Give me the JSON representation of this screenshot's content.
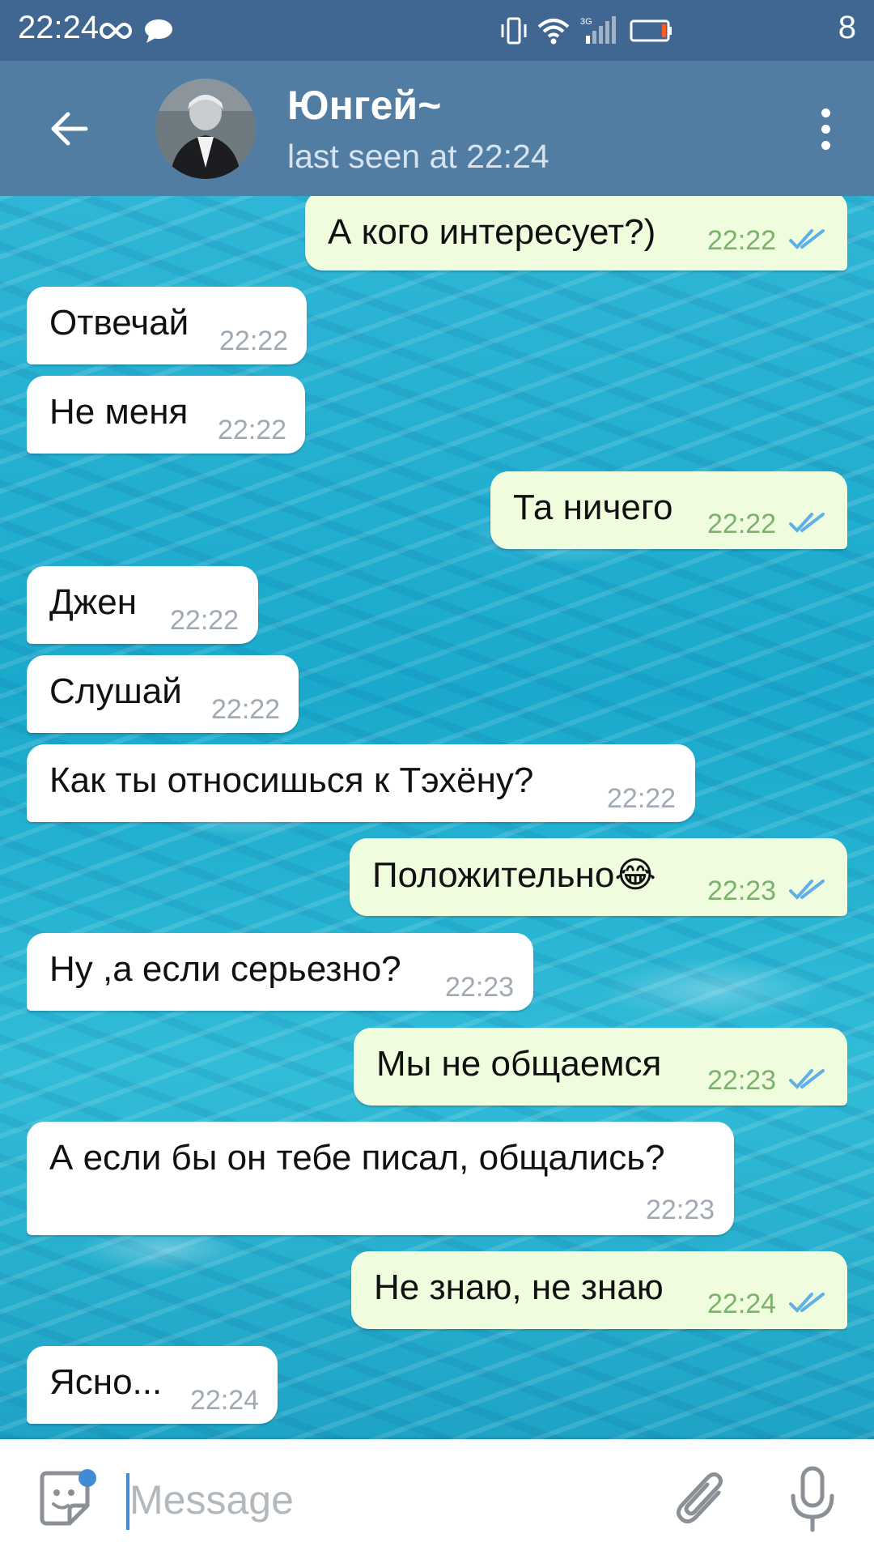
{
  "status_bar": {
    "time": "22:24",
    "battery_level": "8"
  },
  "header": {
    "title": "Юнгей~",
    "status": "last seen at 22:24"
  },
  "messages": [
    {
      "dir": "out",
      "text": "А кого интересует?)",
      "time": "22:22",
      "read": true
    },
    {
      "dir": "in",
      "text": "Отвечай",
      "time": "22:22"
    },
    {
      "dir": "in",
      "text": "Не меня",
      "time": "22:22"
    },
    {
      "dir": "out",
      "text": "Та ничего",
      "time": "22:22",
      "read": true
    },
    {
      "dir": "in",
      "text": "Джен",
      "time": "22:22"
    },
    {
      "dir": "in",
      "text": "Слушай",
      "time": "22:22"
    },
    {
      "dir": "in",
      "text": "Как ты относишься к Тэхёну?",
      "time": "22:22"
    },
    {
      "dir": "out",
      "text": "Положительно😂",
      "time": "22:23",
      "read": true
    },
    {
      "dir": "in",
      "text": "Ну ,а если серьезно?",
      "time": "22:23"
    },
    {
      "dir": "out",
      "text": "Мы не общаемся",
      "time": "22:23",
      "read": true
    },
    {
      "dir": "in",
      "text": "А если бы он тебе писал, общались?",
      "time": "22:23"
    },
    {
      "dir": "out",
      "text": "Не знаю, не знаю",
      "time": "22:24",
      "read": true
    },
    {
      "dir": "in",
      "text": "Ясно...",
      "time": "22:24"
    }
  ],
  "input": {
    "placeholder": "Message",
    "value": ""
  },
  "colors": {
    "header": "#517da2",
    "status_bar": "#3f6791",
    "incoming_bubble": "#ffffff",
    "outgoing_bubble": "#effdde",
    "read_ticks": "#5fb0e8"
  },
  "icons": [
    "back-arrow-icon",
    "more-vert-icon",
    "sticker-icon",
    "attach-icon",
    "microphone-icon",
    "double-check-icon"
  ]
}
